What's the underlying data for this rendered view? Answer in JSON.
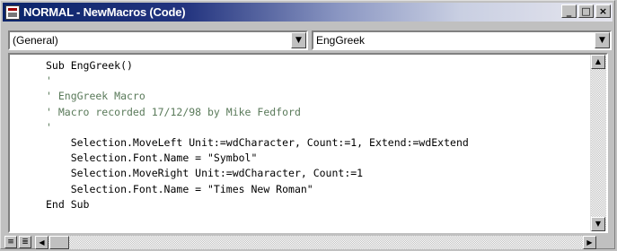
{
  "window": {
    "title": "NORMAL - NewMacros (Code)",
    "buttons": {
      "minimize": "_",
      "maximize": "□",
      "close": "×"
    }
  },
  "object_combo": {
    "value": "(General)",
    "arrow": "▼"
  },
  "procedure_combo": {
    "value": "EngGreek",
    "arrow": "▼"
  },
  "code": {
    "lines": [
      {
        "text": "Sub EngGreek()",
        "kind": "code"
      },
      {
        "text": "'",
        "kind": "comment"
      },
      {
        "text": "' EngGreek Macro",
        "kind": "comment"
      },
      {
        "text": "' Macro recorded 17/12/98 by Mike Fedford",
        "kind": "comment"
      },
      {
        "text": "'",
        "kind": "comment"
      },
      {
        "text": "    Selection.MoveLeft Unit:=wdCharacter, Count:=1, Extend:=wdExtend",
        "kind": "code"
      },
      {
        "text": "    Selection.Font.Name = \"Symbol\"",
        "kind": "code"
      },
      {
        "text": "    Selection.MoveRight Unit:=wdCharacter, Count:=1",
        "kind": "code"
      },
      {
        "text": "    Selection.Font.Name = \"Times New Roman\"",
        "kind": "code"
      },
      {
        "text": "End Sub",
        "kind": "code"
      }
    ]
  },
  "scrollbar": {
    "up_arrow": "▲",
    "down_arrow": "▼",
    "left_arrow": "◀",
    "right_arrow": "▶"
  },
  "view_buttons": {
    "procedure_view": "≡",
    "full_module_view": "≣"
  },
  "icons": {
    "app": "vb-editor-icon"
  }
}
